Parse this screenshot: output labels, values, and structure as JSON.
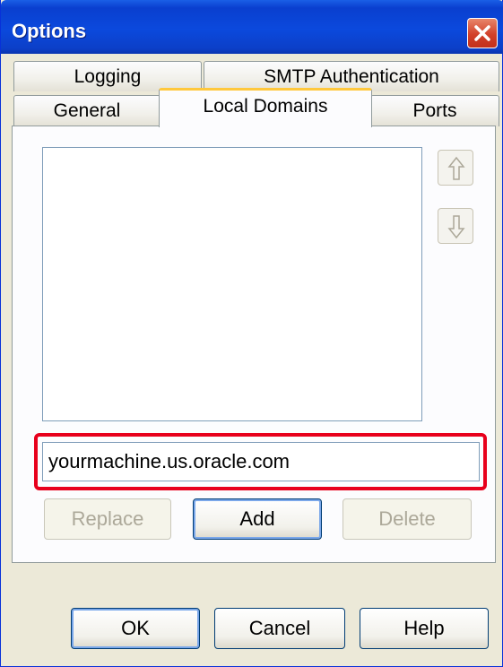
{
  "window": {
    "title": "Options"
  },
  "tabs": {
    "row_back": [
      {
        "label": "Logging"
      },
      {
        "label": "SMTP Authentication"
      }
    ],
    "row_front": [
      {
        "label": "General"
      },
      {
        "label": "Local Domains",
        "active": true
      },
      {
        "label": "Ports"
      }
    ]
  },
  "domains_list": {
    "items": []
  },
  "domain_input": {
    "value": "yourmachine.us.oracle.com"
  },
  "list_buttons": {
    "replace": "Replace",
    "add": "Add",
    "delete": "Delete"
  },
  "dialog_buttons": {
    "ok": "OK",
    "cancel": "Cancel",
    "help": "Help"
  },
  "colors": {
    "titlebar": "#0a3fcf",
    "highlight": "#e8001c",
    "active_tab_accent": "#ffc83c"
  },
  "icons": {
    "close": "close-icon",
    "move_up": "arrow-up-icon",
    "move_down": "arrow-down-icon"
  }
}
